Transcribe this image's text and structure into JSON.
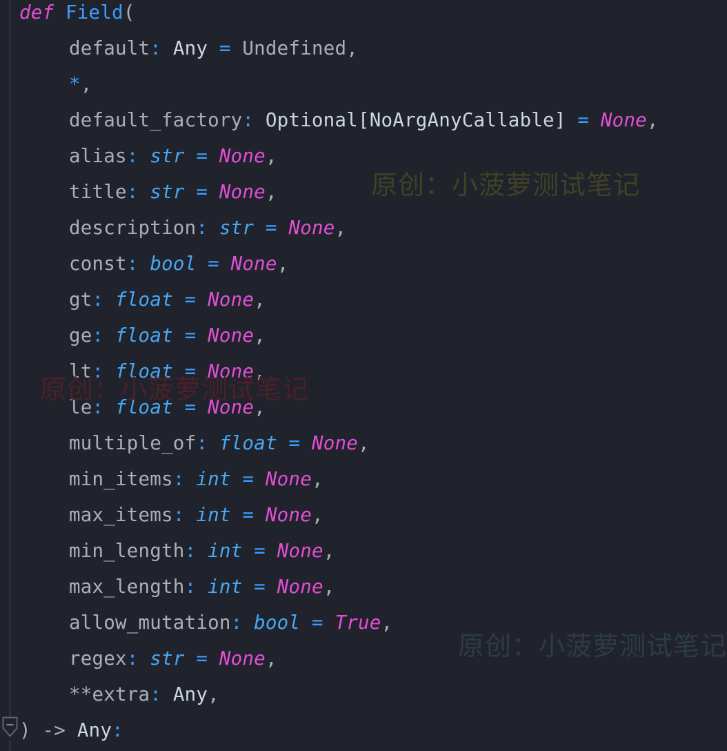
{
  "editor": {
    "background_color": "#20232b",
    "indent_guide_color": "#3d4450",
    "fold_marker_name": "collapse-fold-marker"
  },
  "palette": {
    "keyword": "#e24fd6",
    "function_name": "#3b9dff",
    "identifier": "#a9b0bb",
    "operator": "#3b9dff",
    "type": "#cdd6e5",
    "builtin_type": "#47a8f5",
    "constant": "#e24fd6"
  },
  "code": {
    "language": "python",
    "signature": "def Field(default: Any = Undefined, *, default_factory: Optional[NoArgAnyCallable] = None, alias: str = None, title: str = None, description: str = None, const: bool = None, gt: float = None, ge: float = None, lt: float = None, le: float = None, multiple_of: float = None, min_items: int = None, max_items: int = None, min_length: int = None, max_length: int = None, allow_mutation: bool = True, regex: str = None, **extra: Any,) -> Any:",
    "lines": [
      {
        "indent": 0,
        "tokens": [
          {
            "text": "def",
            "kind": "kw"
          },
          {
            "text": " ",
            "kind": "plain"
          },
          {
            "text": "Field",
            "kind": "fn"
          },
          {
            "text": "(",
            "kind": "punct"
          }
        ]
      },
      {
        "indent": 1,
        "tokens": [
          {
            "text": "default",
            "kind": "plain"
          },
          {
            "text": ":",
            "kind": "op"
          },
          {
            "text": " ",
            "kind": "plain"
          },
          {
            "text": "Any",
            "kind": "type"
          },
          {
            "text": " ",
            "kind": "plain"
          },
          {
            "text": "=",
            "kind": "op"
          },
          {
            "text": " ",
            "kind": "plain"
          },
          {
            "text": "Undefined",
            "kind": "plain"
          },
          {
            "text": ",",
            "kind": "punct"
          }
        ]
      },
      {
        "indent": 1,
        "tokens": [
          {
            "text": "*",
            "kind": "op"
          },
          {
            "text": ",",
            "kind": "punct"
          }
        ]
      },
      {
        "indent": 1,
        "tokens": [
          {
            "text": "default_factory",
            "kind": "plain"
          },
          {
            "text": ":",
            "kind": "op"
          },
          {
            "text": " ",
            "kind": "plain"
          },
          {
            "text": "Optional[NoArgAnyCallable]",
            "kind": "type"
          },
          {
            "text": " ",
            "kind": "plain"
          },
          {
            "text": "=",
            "kind": "op"
          },
          {
            "text": " ",
            "kind": "plain"
          },
          {
            "text": "None",
            "kind": "const"
          },
          {
            "text": ",",
            "kind": "punct"
          }
        ]
      },
      {
        "indent": 1,
        "tokens": [
          {
            "text": "alias",
            "kind": "plain"
          },
          {
            "text": ":",
            "kind": "op"
          },
          {
            "text": " ",
            "kind": "plain"
          },
          {
            "text": "str",
            "kind": "typeit"
          },
          {
            "text": " ",
            "kind": "plain"
          },
          {
            "text": "=",
            "kind": "op"
          },
          {
            "text": " ",
            "kind": "plain"
          },
          {
            "text": "None",
            "kind": "const"
          },
          {
            "text": ",",
            "kind": "punct"
          }
        ]
      },
      {
        "indent": 1,
        "tokens": [
          {
            "text": "title",
            "kind": "plain"
          },
          {
            "text": ":",
            "kind": "op"
          },
          {
            "text": " ",
            "kind": "plain"
          },
          {
            "text": "str",
            "kind": "typeit"
          },
          {
            "text": " ",
            "kind": "plain"
          },
          {
            "text": "=",
            "kind": "op"
          },
          {
            "text": " ",
            "kind": "plain"
          },
          {
            "text": "None",
            "kind": "const"
          },
          {
            "text": ",",
            "kind": "punct"
          }
        ]
      },
      {
        "indent": 1,
        "tokens": [
          {
            "text": "description",
            "kind": "plain"
          },
          {
            "text": ":",
            "kind": "op"
          },
          {
            "text": " ",
            "kind": "plain"
          },
          {
            "text": "str",
            "kind": "typeit"
          },
          {
            "text": " ",
            "kind": "plain"
          },
          {
            "text": "=",
            "kind": "op"
          },
          {
            "text": " ",
            "kind": "plain"
          },
          {
            "text": "None",
            "kind": "const"
          },
          {
            "text": ",",
            "kind": "punct"
          }
        ]
      },
      {
        "indent": 1,
        "tokens": [
          {
            "text": "const",
            "kind": "plain"
          },
          {
            "text": ":",
            "kind": "op"
          },
          {
            "text": " ",
            "kind": "plain"
          },
          {
            "text": "bool",
            "kind": "typeit"
          },
          {
            "text": " ",
            "kind": "plain"
          },
          {
            "text": "=",
            "kind": "op"
          },
          {
            "text": " ",
            "kind": "plain"
          },
          {
            "text": "None",
            "kind": "const"
          },
          {
            "text": ",",
            "kind": "punct"
          }
        ]
      },
      {
        "indent": 1,
        "tokens": [
          {
            "text": "gt",
            "kind": "plain"
          },
          {
            "text": ":",
            "kind": "op"
          },
          {
            "text": " ",
            "kind": "plain"
          },
          {
            "text": "float",
            "kind": "typeit"
          },
          {
            "text": " ",
            "kind": "plain"
          },
          {
            "text": "=",
            "kind": "op"
          },
          {
            "text": " ",
            "kind": "plain"
          },
          {
            "text": "None",
            "kind": "const"
          },
          {
            "text": ",",
            "kind": "punct"
          }
        ]
      },
      {
        "indent": 1,
        "tokens": [
          {
            "text": "ge",
            "kind": "plain"
          },
          {
            "text": ":",
            "kind": "op"
          },
          {
            "text": " ",
            "kind": "plain"
          },
          {
            "text": "float",
            "kind": "typeit"
          },
          {
            "text": " ",
            "kind": "plain"
          },
          {
            "text": "=",
            "kind": "op"
          },
          {
            "text": " ",
            "kind": "plain"
          },
          {
            "text": "None",
            "kind": "const"
          },
          {
            "text": ",",
            "kind": "punct"
          }
        ]
      },
      {
        "indent": 1,
        "tokens": [
          {
            "text": "lt",
            "kind": "plain"
          },
          {
            "text": ":",
            "kind": "op"
          },
          {
            "text": " ",
            "kind": "plain"
          },
          {
            "text": "float",
            "kind": "typeit"
          },
          {
            "text": " ",
            "kind": "plain"
          },
          {
            "text": "=",
            "kind": "op"
          },
          {
            "text": " ",
            "kind": "plain"
          },
          {
            "text": "None",
            "kind": "const"
          },
          {
            "text": ",",
            "kind": "punct"
          }
        ]
      },
      {
        "indent": 1,
        "tokens": [
          {
            "text": "le",
            "kind": "plain"
          },
          {
            "text": ":",
            "kind": "op"
          },
          {
            "text": " ",
            "kind": "plain"
          },
          {
            "text": "float",
            "kind": "typeit"
          },
          {
            "text": " ",
            "kind": "plain"
          },
          {
            "text": "=",
            "kind": "op"
          },
          {
            "text": " ",
            "kind": "plain"
          },
          {
            "text": "None",
            "kind": "const"
          },
          {
            "text": ",",
            "kind": "punct"
          }
        ]
      },
      {
        "indent": 1,
        "tokens": [
          {
            "text": "multiple_of",
            "kind": "plain"
          },
          {
            "text": ":",
            "kind": "op"
          },
          {
            "text": " ",
            "kind": "plain"
          },
          {
            "text": "float",
            "kind": "typeit"
          },
          {
            "text": " ",
            "kind": "plain"
          },
          {
            "text": "=",
            "kind": "op"
          },
          {
            "text": " ",
            "kind": "plain"
          },
          {
            "text": "None",
            "kind": "const"
          },
          {
            "text": ",",
            "kind": "punct"
          }
        ]
      },
      {
        "indent": 1,
        "tokens": [
          {
            "text": "min_items",
            "kind": "plain"
          },
          {
            "text": ":",
            "kind": "op"
          },
          {
            "text": " ",
            "kind": "plain"
          },
          {
            "text": "int",
            "kind": "typeit"
          },
          {
            "text": " ",
            "kind": "plain"
          },
          {
            "text": "=",
            "kind": "op"
          },
          {
            "text": " ",
            "kind": "plain"
          },
          {
            "text": "None",
            "kind": "const"
          },
          {
            "text": ",",
            "kind": "punct"
          }
        ]
      },
      {
        "indent": 1,
        "tokens": [
          {
            "text": "max_items",
            "kind": "plain"
          },
          {
            "text": ":",
            "kind": "op"
          },
          {
            "text": " ",
            "kind": "plain"
          },
          {
            "text": "int",
            "kind": "typeit"
          },
          {
            "text": " ",
            "kind": "plain"
          },
          {
            "text": "=",
            "kind": "op"
          },
          {
            "text": " ",
            "kind": "plain"
          },
          {
            "text": "None",
            "kind": "const"
          },
          {
            "text": ",",
            "kind": "punct"
          }
        ]
      },
      {
        "indent": 1,
        "tokens": [
          {
            "text": "min_length",
            "kind": "plain"
          },
          {
            "text": ":",
            "kind": "op"
          },
          {
            "text": " ",
            "kind": "plain"
          },
          {
            "text": "int",
            "kind": "typeit"
          },
          {
            "text": " ",
            "kind": "plain"
          },
          {
            "text": "=",
            "kind": "op"
          },
          {
            "text": " ",
            "kind": "plain"
          },
          {
            "text": "None",
            "kind": "const"
          },
          {
            "text": ",",
            "kind": "punct"
          }
        ]
      },
      {
        "indent": 1,
        "tokens": [
          {
            "text": "max_length",
            "kind": "plain"
          },
          {
            "text": ":",
            "kind": "op"
          },
          {
            "text": " ",
            "kind": "plain"
          },
          {
            "text": "int",
            "kind": "typeit"
          },
          {
            "text": " ",
            "kind": "plain"
          },
          {
            "text": "=",
            "kind": "op"
          },
          {
            "text": " ",
            "kind": "plain"
          },
          {
            "text": "None",
            "kind": "const"
          },
          {
            "text": ",",
            "kind": "punct"
          }
        ]
      },
      {
        "indent": 1,
        "tokens": [
          {
            "text": "allow_mutation",
            "kind": "plain"
          },
          {
            "text": ":",
            "kind": "op"
          },
          {
            "text": " ",
            "kind": "plain"
          },
          {
            "text": "bool",
            "kind": "typeit"
          },
          {
            "text": " ",
            "kind": "plain"
          },
          {
            "text": "=",
            "kind": "op"
          },
          {
            "text": " ",
            "kind": "plain"
          },
          {
            "text": "True",
            "kind": "const"
          },
          {
            "text": ",",
            "kind": "punct"
          }
        ]
      },
      {
        "indent": 1,
        "tokens": [
          {
            "text": "regex",
            "kind": "plain"
          },
          {
            "text": ":",
            "kind": "op"
          },
          {
            "text": " ",
            "kind": "plain"
          },
          {
            "text": "str",
            "kind": "typeit"
          },
          {
            "text": " ",
            "kind": "plain"
          },
          {
            "text": "=",
            "kind": "op"
          },
          {
            "text": " ",
            "kind": "plain"
          },
          {
            "text": "None",
            "kind": "const"
          },
          {
            "text": ",",
            "kind": "punct"
          }
        ]
      },
      {
        "indent": 1,
        "tokens": [
          {
            "text": "**",
            "kind": "plain"
          },
          {
            "text": "extra",
            "kind": "plain"
          },
          {
            "text": ":",
            "kind": "op"
          },
          {
            "text": " ",
            "kind": "plain"
          },
          {
            "text": "Any",
            "kind": "type"
          },
          {
            "text": ",",
            "kind": "punct"
          }
        ]
      },
      {
        "indent": 0,
        "tokens": [
          {
            "text": ")",
            "kind": "punct"
          },
          {
            "text": " ",
            "kind": "plain"
          },
          {
            "text": "->",
            "kind": "plain"
          },
          {
            "text": " ",
            "kind": "plain"
          },
          {
            "text": "Any",
            "kind": "type"
          },
          {
            "text": ":",
            "kind": "op"
          }
        ]
      }
    ]
  },
  "watermarks": [
    {
      "name": "watermark-olive",
      "text": "原创：小菠萝测试笔记",
      "color": "#3f4226"
    },
    {
      "name": "watermark-red",
      "text": "原创：小菠萝测试笔记",
      "color": "#4a2029"
    },
    {
      "name": "watermark-teal",
      "text": "原创：小菠萝测试笔记",
      "color": "#2c3b47"
    }
  ]
}
